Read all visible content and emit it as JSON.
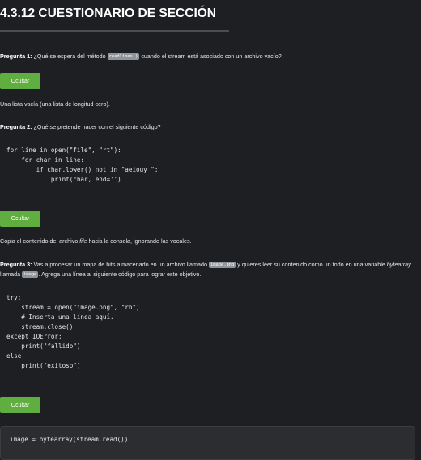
{
  "title": "4.3.12 CUESTIONARIO DE SECCIÓN",
  "button_label": "Ocultar",
  "q1": {
    "label": "Pregunta 1:",
    "text_before": " ¿Qué se espera del método ",
    "code": "readlines()",
    "text_after": " cuando el stream está asociado con un archivo vacío?",
    "answer": "Una lista vacía (una lista de longitud cero)."
  },
  "q2": {
    "label": "Pregunta 2:",
    "text": " ¿Qué se pretende hacer con el siguiente código?",
    "code": "for line in open(\"file\", \"rt\"):\n    for char in line:\n        if char.lower() not in \"aeiouy \":\n            print(char, end='')",
    "answer_before": "Copia el contenido del archivo ",
    "answer_em": "file",
    "answer_after": " hacia la consola, ignorando las vocales."
  },
  "q3": {
    "label": "Pregunta 3:",
    "text_1": " Vas a procesar un mapa de bits almacenado en un archivo llamado ",
    "code_1": "image.png",
    "text_2": " y quieres leer su contenido como un todo en una variable ",
    "em": "bytearray",
    "text_3": " llamada ",
    "code_2": "image",
    "text_4": ". Agrega una línea al siguiente código para lograr este objetivo.",
    "code": "try:\n    stream = open(\"image.png\", \"rb\")\n    # Inserta una línea aquí.\n    stream.close()\nexcept IOError:\n    print(\"fallido\")\nelse:\n    print(\"exitoso\")",
    "answer_code": "image = bytearray(stream.read())"
  }
}
